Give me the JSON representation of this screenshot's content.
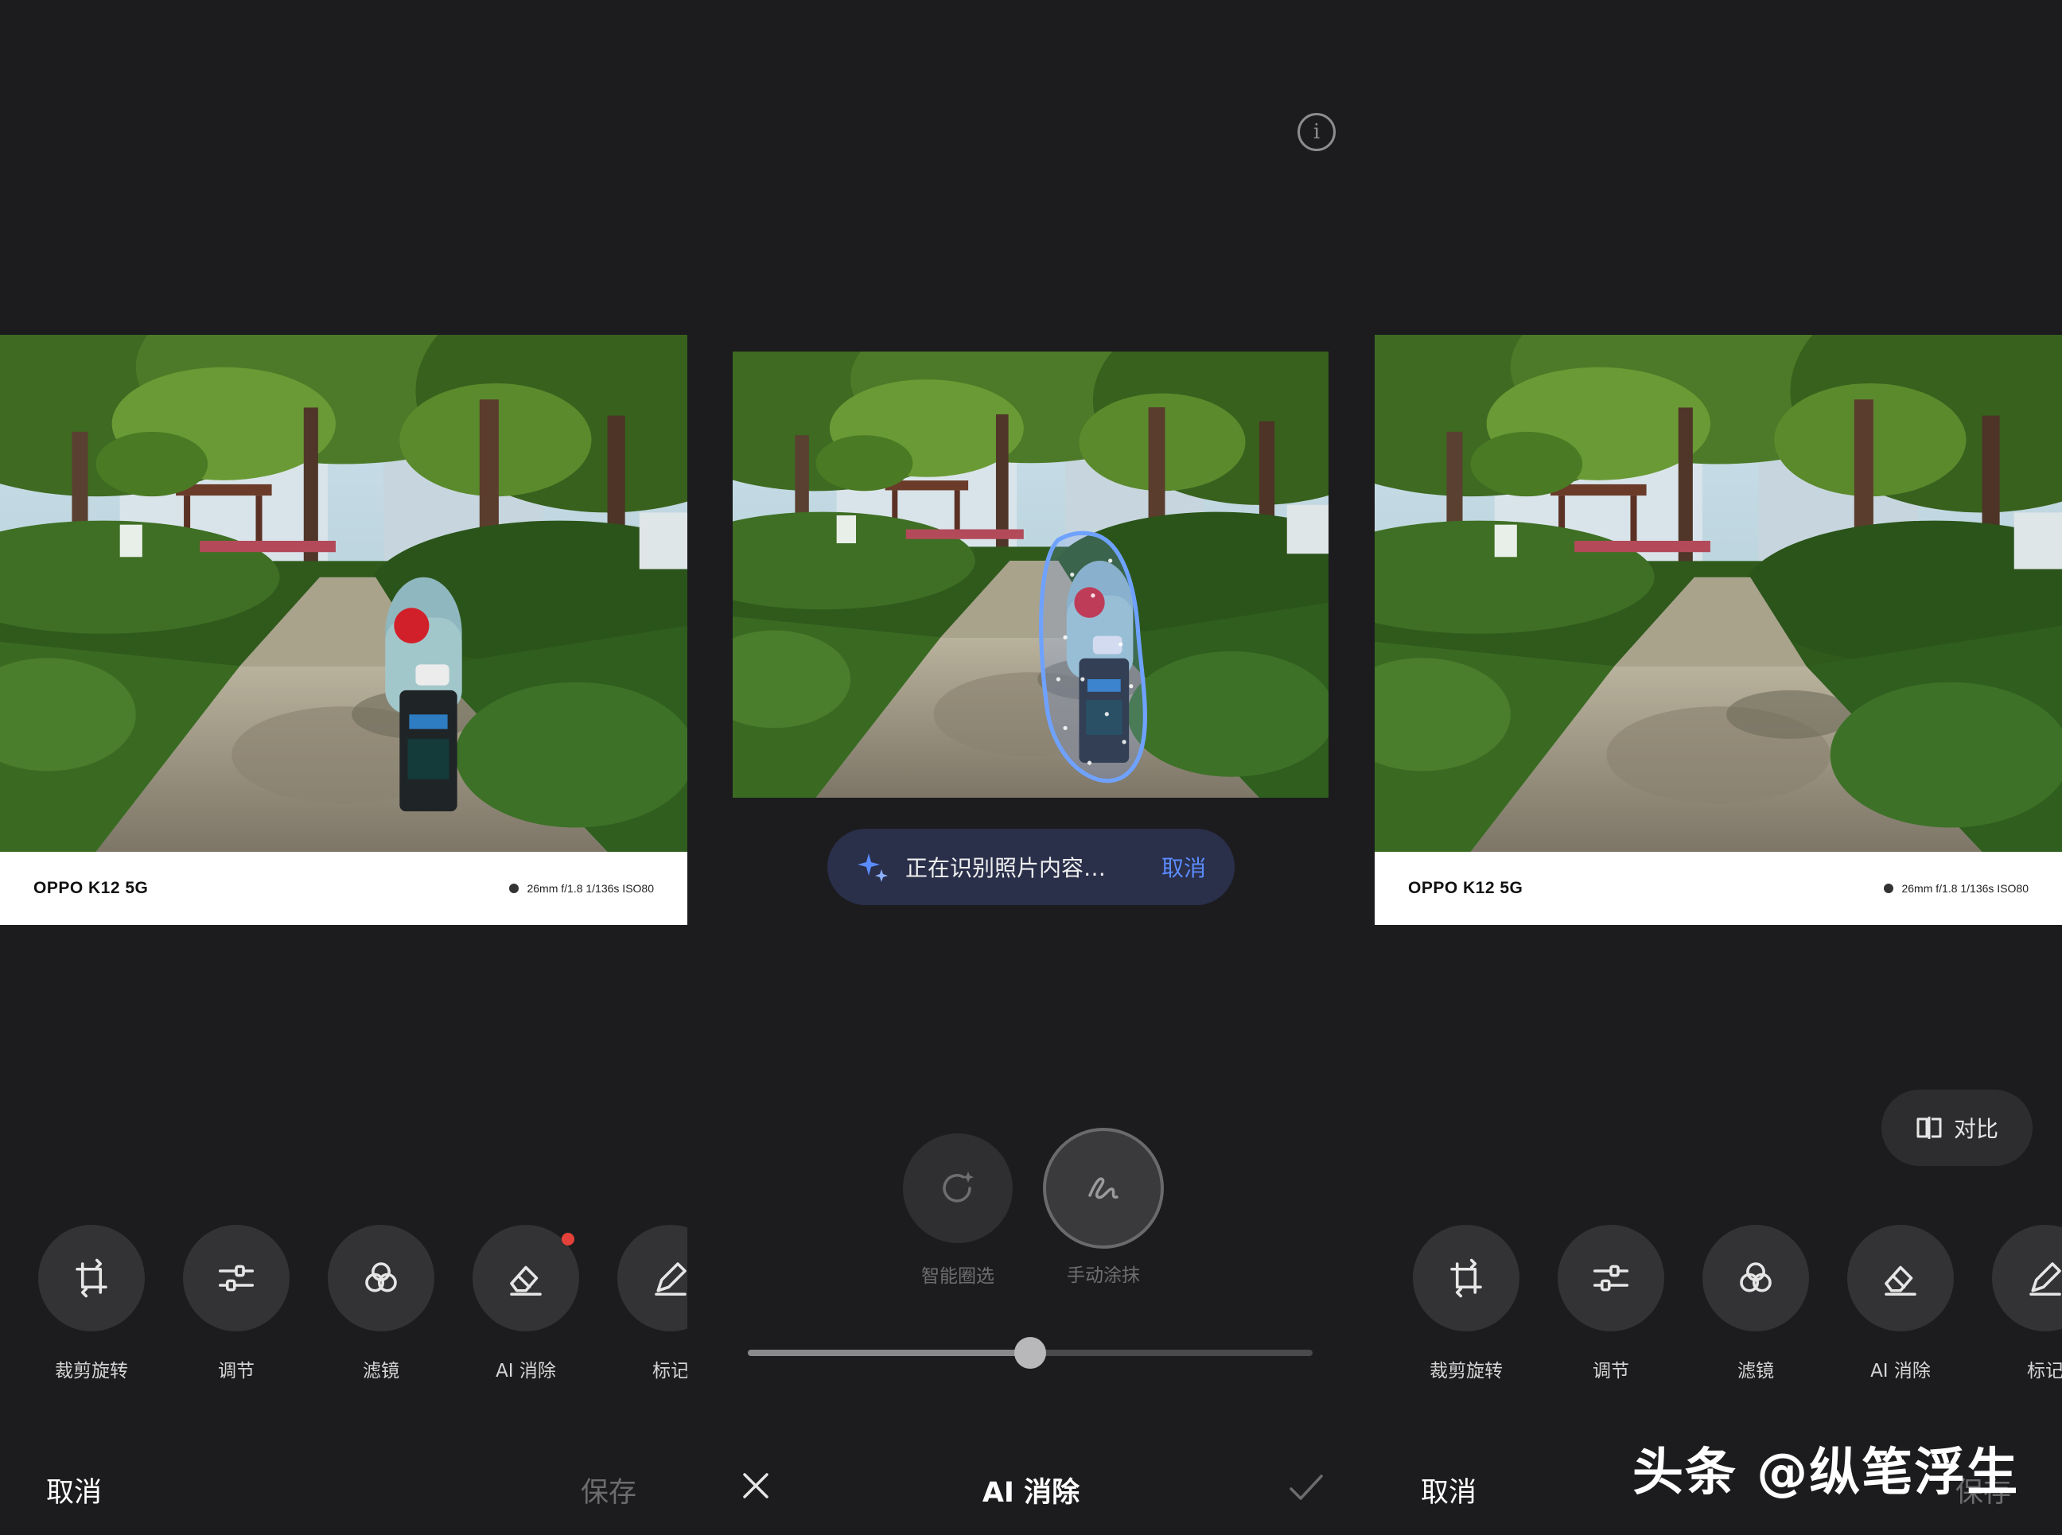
{
  "left": {
    "watermark": {
      "model": "OPPO K12 5G",
      "params": "26mm  f/1.8  1/136s  ISO80"
    },
    "tools": [
      {
        "label": "裁剪旋转",
        "icon": "crop-rotate-icon"
      },
      {
        "label": "调节",
        "icon": "sliders-icon"
      },
      {
        "label": "滤镜",
        "icon": "filter-circles-icon"
      },
      {
        "label": "AI 消除",
        "icon": "eraser-icon",
        "badge": true
      },
      {
        "label": "标记",
        "icon": "pen-icon"
      }
    ],
    "cancel": "取消",
    "save": "保存"
  },
  "middle": {
    "toast": {
      "text": "正在识别照片内容…",
      "cancel": "取消",
      "icon": "sparkle-icon"
    },
    "modes": [
      {
        "label": "智能圈选",
        "icon": "smart-lasso-icon"
      },
      {
        "label": "手动涂抹",
        "icon": "brush-stroke-icon",
        "selected": true
      }
    ],
    "brush_size_fraction": 0.5,
    "title": "AI 消除",
    "close_icon": "close-icon",
    "confirm_icon": "check-icon"
  },
  "right": {
    "watermark": {
      "model": "OPPO K12 5G",
      "params": "26mm  f/1.8  1/136s  ISO80"
    },
    "compare": "对比",
    "tools": [
      {
        "label": "裁剪旋转",
        "icon": "crop-rotate-icon"
      },
      {
        "label": "调节",
        "icon": "sliders-icon"
      },
      {
        "label": "滤镜",
        "icon": "filter-circles-icon"
      },
      {
        "label": "AI 消除",
        "icon": "eraser-icon"
      },
      {
        "label": "标记",
        "icon": "pen-icon"
      }
    ],
    "cancel": "取消",
    "save": "保存"
  },
  "credit": "头条 @纵笔浮生",
  "colors": {
    "accent": "#5b8cff",
    "badge": "#e5413b",
    "background": "#1c1c1e",
    "toast": "#2a2f4a"
  }
}
